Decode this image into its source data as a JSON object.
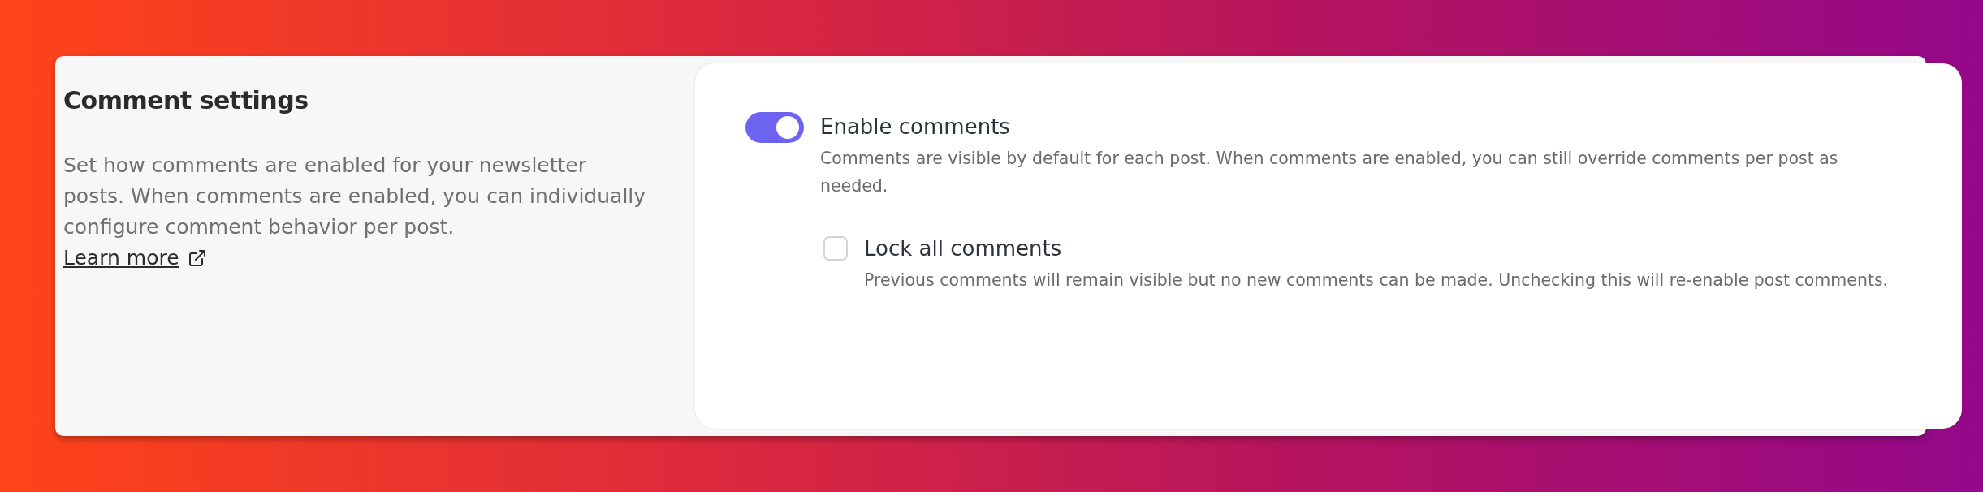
{
  "section": {
    "title": "Comment settings",
    "description": "Set how comments are enabled for your newsletter posts. When comments are enabled, you can individually configure comment behavior per post.",
    "link": "Learn more"
  },
  "settings": [
    {
      "kind": "toggle",
      "label": "Enable comments",
      "on": true,
      "help": "Comments are visible by default for each post. When comments are enabled, you can still override comments per post as needed."
    },
    {
      "kind": "checkbox",
      "label": "Lock all comments",
      "checked": false,
      "help": "Previous comments will remain visible but no new comments can be made. Unchecking this will re-enable post comments."
    }
  ]
}
